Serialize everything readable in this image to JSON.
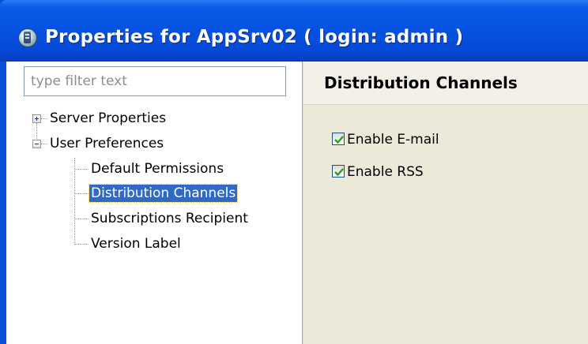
{
  "window": {
    "title": "Properties for AppSrv02 ( login: admin )"
  },
  "filter": {
    "placeholder": "type filter text",
    "value": ""
  },
  "tree": {
    "items": [
      {
        "label": "Server Properties",
        "expanded": false
      },
      {
        "label": "User Preferences",
        "expanded": true
      },
      {
        "label": "Default Permissions"
      },
      {
        "label": "Distribution Channels",
        "selected": true
      },
      {
        "label": "Subscriptions Recipient"
      },
      {
        "label": "Version Label"
      }
    ]
  },
  "page": {
    "title": "Distribution Channels",
    "options": [
      {
        "label": "Enable E-mail",
        "checked": true
      },
      {
        "label": "Enable RSS",
        "checked": true
      }
    ]
  },
  "colors": {
    "titlebar": "#0651e0",
    "selection": "#316ac5",
    "panel": "#ece9d8",
    "check": "#21a121"
  }
}
